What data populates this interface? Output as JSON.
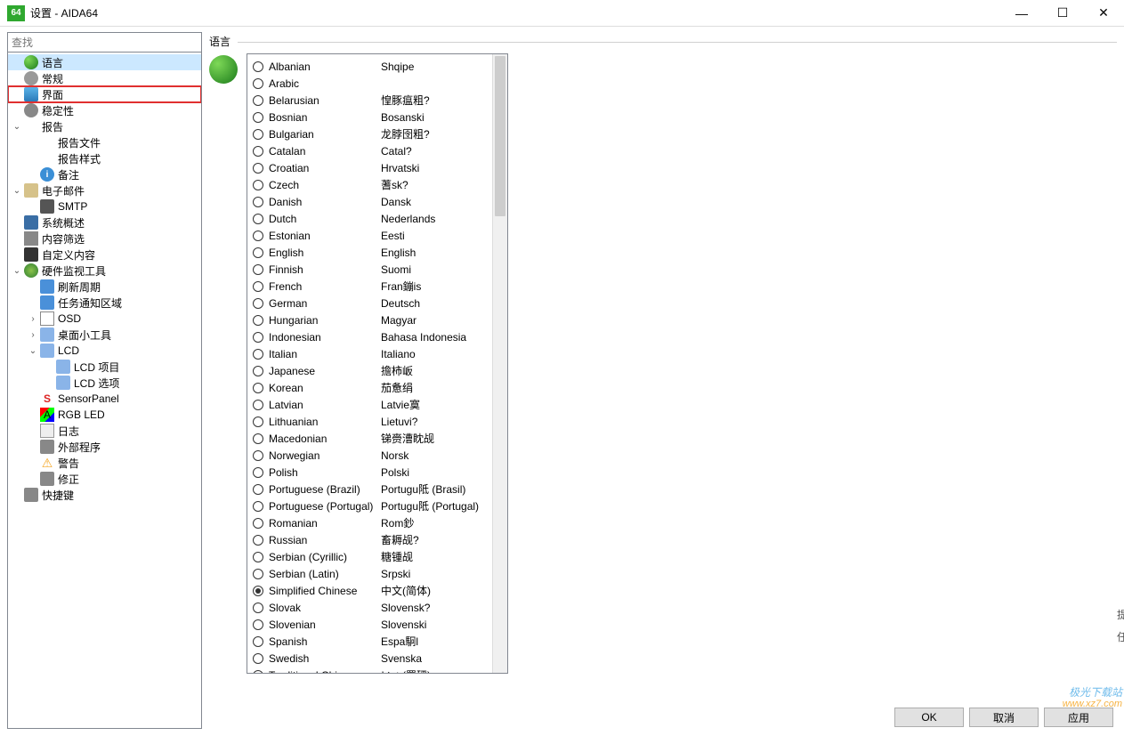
{
  "window": {
    "app_badge": "64",
    "title": "设置 - AIDA64",
    "min": "—",
    "max": "☐",
    "close": "✕"
  },
  "search_placeholder": "查找",
  "tree": [
    {
      "icon": "ic-globe",
      "label": "语言",
      "depth": 0,
      "selected": true
    },
    {
      "icon": "ic-gear",
      "label": "常规",
      "depth": 0
    },
    {
      "icon": "ic-screen",
      "label": "界面",
      "depth": 0,
      "highlighted": true
    },
    {
      "icon": "ic-stab",
      "label": "稳定性",
      "depth": 0
    },
    {
      "icon": "ic-report",
      "label": "报告",
      "depth": 0,
      "expander": "v"
    },
    {
      "icon": "ic-file",
      "label": "报告文件",
      "depth": 1
    },
    {
      "icon": "ic-doc",
      "label": "报告样式",
      "depth": 1
    },
    {
      "icon": "ic-info",
      "label": "备注",
      "depth": 1,
      "iconText": "i"
    },
    {
      "icon": "ic-mail",
      "label": "电子邮件",
      "depth": 0,
      "expander": "v"
    },
    {
      "icon": "ic-phone",
      "label": "SMTP",
      "depth": 1
    },
    {
      "icon": "ic-monitor",
      "label": "系统概述",
      "depth": 0
    },
    {
      "icon": "ic-filter",
      "label": "内容筛选",
      "depth": 0
    },
    {
      "icon": "ic-custom",
      "label": "自定义内容",
      "depth": 0
    },
    {
      "icon": "ic-tool",
      "label": "硬件监视工具",
      "depth": 0,
      "expander": "v"
    },
    {
      "icon": "ic-refresh",
      "label": "刷新周期",
      "depth": 1
    },
    {
      "icon": "ic-notify",
      "label": "任务通知区域",
      "depth": 1
    },
    {
      "icon": "ic-osd",
      "label": "OSD",
      "depth": 1,
      "expander": ">"
    },
    {
      "icon": "ic-widget",
      "label": "桌面小工具",
      "depth": 1,
      "expander": ">"
    },
    {
      "icon": "ic-lcd",
      "label": "LCD",
      "depth": 1,
      "expander": "v"
    },
    {
      "icon": "ic-lcd",
      "label": "LCD 项目",
      "depth": 2
    },
    {
      "icon": "ic-lcd",
      "label": "LCD 选项",
      "depth": 2
    },
    {
      "icon": "ic-sensor",
      "label": "SensorPanel",
      "depth": 1,
      "iconText": "S"
    },
    {
      "icon": "ic-rgb",
      "label": "RGB LED",
      "depth": 1,
      "iconText": "A"
    },
    {
      "icon": "ic-log",
      "label": "日志",
      "depth": 1
    },
    {
      "icon": "ic-ext",
      "label": "外部程序",
      "depth": 1
    },
    {
      "icon": "ic-warn",
      "label": "警告",
      "depth": 1,
      "iconText": "⚠"
    },
    {
      "icon": "ic-fix",
      "label": "修正",
      "depth": 1
    },
    {
      "icon": "ic-key",
      "label": "快捷键",
      "depth": 0
    }
  ],
  "section_title": "语言",
  "languages": [
    {
      "en": "Albanian",
      "native": "Shqipe"
    },
    {
      "en": "Arabic",
      "native": ""
    },
    {
      "en": "Belarusian",
      "native": "惶豚瘟粗?"
    },
    {
      "en": "Bosnian",
      "native": "Bosanski"
    },
    {
      "en": "Bulgarian",
      "native": "龙脖囹粗?"
    },
    {
      "en": "Catalan",
      "native": "Catal?"
    },
    {
      "en": "Croatian",
      "native": "Hrvatski"
    },
    {
      "en": "Czech",
      "native": "蓍sk?"
    },
    {
      "en": "Danish",
      "native": "Dansk"
    },
    {
      "en": "Dutch",
      "native": "Nederlands"
    },
    {
      "en": "Estonian",
      "native": "Eesti"
    },
    {
      "en": "English",
      "native": "English"
    },
    {
      "en": "Finnish",
      "native": "Suomi"
    },
    {
      "en": "French",
      "native": "Fran鏰is"
    },
    {
      "en": "German",
      "native": "Deutsch"
    },
    {
      "en": "Hungarian",
      "native": "Magyar"
    },
    {
      "en": "Indonesian",
      "native": "Bahasa Indonesia"
    },
    {
      "en": "Italian",
      "native": "Italiano"
    },
    {
      "en": "Japanese",
      "native": "擔柿岅"
    },
    {
      "en": "Korean",
      "native": "茄惫绢"
    },
    {
      "en": "Latvian",
      "native": "Latvie寞"
    },
    {
      "en": "Lithuanian",
      "native": "Lietuvi?"
    },
    {
      "en": "Macedonian",
      "native": "锑赍漕眈觇"
    },
    {
      "en": "Norwegian",
      "native": "Norsk"
    },
    {
      "en": "Polish",
      "native": "Polski"
    },
    {
      "en": "Portuguese (Brazil)",
      "native": "Portugu阺 (Brasil)"
    },
    {
      "en": "Portuguese (Portugal)",
      "native": "Portugu阺 (Portugal)"
    },
    {
      "en": "Romanian",
      "native": "Rom鈔"
    },
    {
      "en": "Russian",
      "native": "畜耨觇?"
    },
    {
      "en": "Serbian (Cyrillic)",
      "native": "糖锺觇"
    },
    {
      "en": "Serbian (Latin)",
      "native": "Srpski"
    },
    {
      "en": "Simplified Chinese",
      "native": "中文(简体)",
      "selected": true
    },
    {
      "en": "Slovak",
      "native": "Slovensk?"
    },
    {
      "en": "Slovenian",
      "native": "Slovenski"
    },
    {
      "en": "Spanish",
      "native": "Espa駉l"
    },
    {
      "en": "Swedish",
      "native": "Svenska"
    },
    {
      "en": "Traditional Chinese",
      "native": "いゅ(羉砰)"
    }
  ],
  "buttons": {
    "ok": "OK",
    "cancel": "取消",
    "apply": "应用"
  },
  "watermark": {
    "line1": "极光下载站",
    "line2": "www.xz7.com"
  },
  "side_hints": [
    "提",
    "任"
  ]
}
